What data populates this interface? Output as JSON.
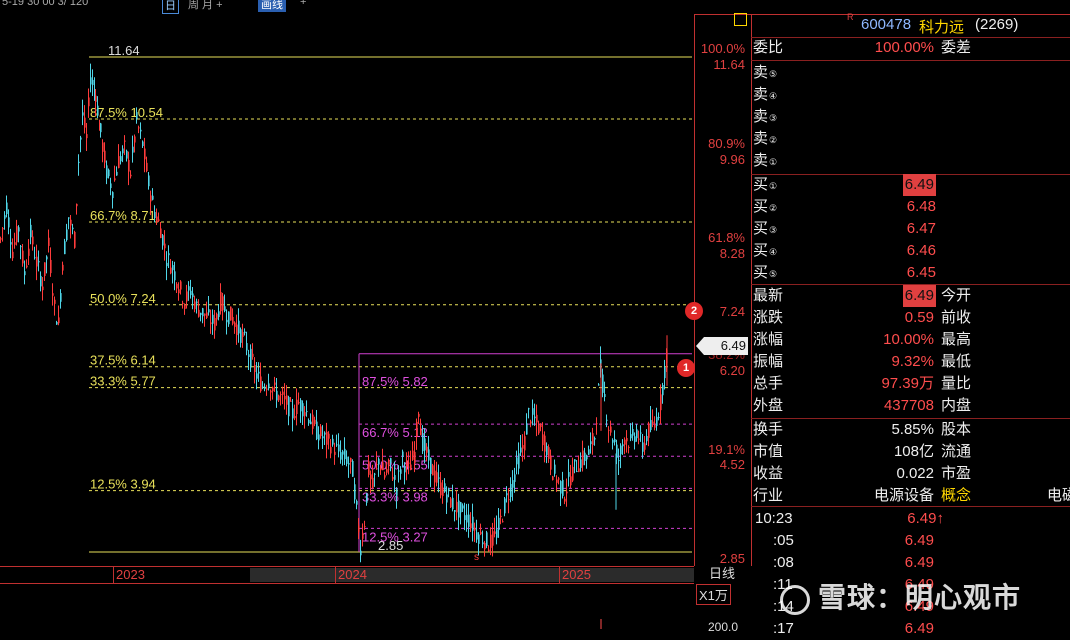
{
  "topbar": {
    "left_text": "5-19 30 00 3/ 120",
    "period_btn": "日",
    "period_label": "周 月 +",
    "extra_btn": "画线",
    "tail": "+"
  },
  "chart": {
    "fib_main": [
      {
        "label": "11.64",
        "price": 11.64
      },
      {
        "label": "87.5% 10.54",
        "price": 10.54
      },
      {
        "label": "66.7% 8.71",
        "price": 8.71
      },
      {
        "label": "50.0% 7.24",
        "price": 7.24
      },
      {
        "label": "37.5% 6.14",
        "price": 6.14
      },
      {
        "label": "33.3% 5.77",
        "price": 5.77
      },
      {
        "label": "12.5% 3.94",
        "price": 3.94
      },
      {
        "label": "2.85",
        "price": 2.85
      }
    ],
    "fib_sub": [
      {
        "label": "87.5% 5.82",
        "price": 6.37
      },
      {
        "label": "66.7% 5.12",
        "price": 5.12
      },
      {
        "label": "50.0% 4.55",
        "price": 4.55
      },
      {
        "label": "33.3% 3.98",
        "price": 3.98
      },
      {
        "label": "12.5% 3.27",
        "price": 3.27
      }
    ],
    "axis_labels": [
      {
        "pct": "100.0%",
        "price": "11.64"
      },
      {
        "pct": "80.9%",
        "price": "9.96"
      },
      {
        "pct": "61.8%",
        "price": "8.28"
      },
      {
        "pct": "",
        "price": "7.24"
      },
      {
        "pct": "38.2%",
        "price": "6.20"
      },
      {
        "pct": "19.1%",
        "price": "4.52"
      },
      {
        "pct": "",
        "price": "2.85"
      }
    ],
    "badge_1": "1",
    "badge_2": "2",
    "current_price": "6.49",
    "s_marker": "s",
    "years": [
      "2023",
      "2024",
      "2025"
    ],
    "period": "日线",
    "vol_unit": "X1万",
    "vol_value": "200.0"
  },
  "quote": {
    "r_mark": "R",
    "code": "600478",
    "name": "科力远",
    "num": "(2269)",
    "weibi_label": "委比",
    "weibi_value": "100.00%",
    "weicha_label": "委差",
    "sell": [
      {
        "label": "卖",
        "n": "⑤",
        "price": "",
        "vol": ""
      },
      {
        "label": "卖",
        "n": "④",
        "price": "",
        "vol": ""
      },
      {
        "label": "卖",
        "n": "③",
        "price": "",
        "vol": ""
      },
      {
        "label": "卖",
        "n": "②",
        "price": "",
        "vol": ""
      },
      {
        "label": "卖",
        "n": "①",
        "price": "",
        "vol": ""
      }
    ],
    "buy": [
      {
        "label": "买",
        "n": "①",
        "price": "6.49"
      },
      {
        "label": "买",
        "n": "②",
        "price": "6.48"
      },
      {
        "label": "买",
        "n": "③",
        "price": "6.47"
      },
      {
        "label": "买",
        "n": "④",
        "price": "6.46"
      },
      {
        "label": "买",
        "n": "⑤",
        "price": "6.45"
      }
    ],
    "stats": [
      {
        "l1": "最新",
        "v1": "6.49",
        "l2": "今开"
      },
      {
        "l1": "涨跌",
        "v1": "0.59",
        "l2": "前收"
      },
      {
        "l1": "涨幅",
        "v1": "10.00%",
        "l2": "最高"
      },
      {
        "l1": "振幅",
        "v1": "9.32%",
        "l2": "最低"
      },
      {
        "l1": "总手",
        "v1": "97.39万",
        "l2": "量比"
      },
      {
        "l1": "外盘",
        "v1": "437708",
        "l2": "内盘"
      }
    ],
    "stats2": [
      {
        "l1": "换手",
        "v1": "5.85%",
        "l2": "股本"
      },
      {
        "l1": "市值",
        "v1": "108亿",
        "l2": "流通"
      },
      {
        "l1": "收益",
        "v1": "0.022",
        "l2": "市盈"
      },
      {
        "l1": "行业",
        "v1": "电源设备",
        "l2": "概念",
        "l3": "电磁"
      }
    ],
    "ticks": [
      {
        "time": "10:23",
        "price": "6.49↑"
      },
      {
        "time": ":05",
        "price": "6.49"
      },
      {
        "time": ":08",
        "price": "6.49"
      },
      {
        "time": ":11",
        "price": "6.49"
      },
      {
        "time": ":14",
        "price": "6.49"
      },
      {
        "time": ":17",
        "price": "6.49"
      }
    ]
  },
  "watermark": "雪球：明心观市"
}
